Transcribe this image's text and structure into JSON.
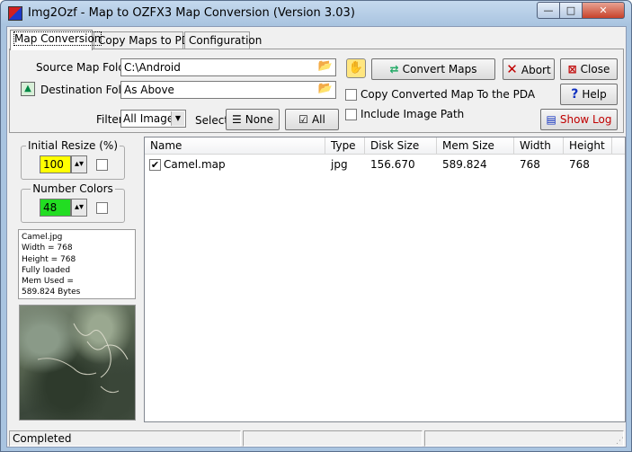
{
  "window": {
    "title": "Img2Ozf - Map to OZFX3 Map Conversion (Version 3.03)",
    "controls": {
      "minimize": "—",
      "maximize": "□",
      "close": "✕"
    }
  },
  "tabs": [
    {
      "label": "Map Conversion"
    },
    {
      "label": "Copy Maps to PDA"
    },
    {
      "label": "Configuration"
    }
  ],
  "conversion": {
    "source_label": "Source Map Folder",
    "source_value": "C:\\Android",
    "destination_label": "Destination Folder",
    "destination_value": "As Above",
    "filter_label": "Filter",
    "filter_value": "All Images",
    "select_label": "Select",
    "none_button": "None",
    "all_button": "All",
    "convert_button": "Convert Maps",
    "abort_button": "Abort",
    "close_button": "Close",
    "help_button": "Help",
    "showlog_button": "Show Log",
    "copy_to_pda_label": "Copy Converted Map To the PDA",
    "include_image_path_label": "Include Image Path"
  },
  "left_panel": {
    "initial_resize_title": "Initial Resize (%)",
    "initial_resize_value": "100",
    "number_colors_title": "Number Colors",
    "number_colors_value": "48",
    "info_lines": [
      "Camel.jpg",
      "Width = 768",
      "Height = 768",
      "Fully loaded",
      "Mem Used =",
      "589.824 Bytes"
    ]
  },
  "file_list": {
    "columns": [
      "Name",
      "Type",
      "Disk Size",
      "Mem Size",
      "Width",
      "Height"
    ],
    "rows": [
      {
        "checked": true,
        "name": "Camel.map",
        "type": "jpg",
        "disk_size": "156.670",
        "mem_size": "589.824",
        "width": "768",
        "height": "768"
      }
    ]
  },
  "status": {
    "text": "Completed",
    "panel2": "",
    "panel3": ""
  },
  "colors": {
    "resize_field_bg": "#ffff00",
    "colors_field_bg": "#22dd22",
    "abort_icon": "#c00000",
    "close_icon": "#c00000",
    "help_icon": "#1030c0",
    "showlog_text": "#c00000"
  },
  "icons": {
    "app": "app-icon",
    "folder": "folder-open-icon",
    "up": "up-arrow-icon",
    "convert": "convert-icon",
    "abort": "x-icon",
    "close": "close-box-icon",
    "help": "question-icon",
    "log": "log-icon"
  }
}
